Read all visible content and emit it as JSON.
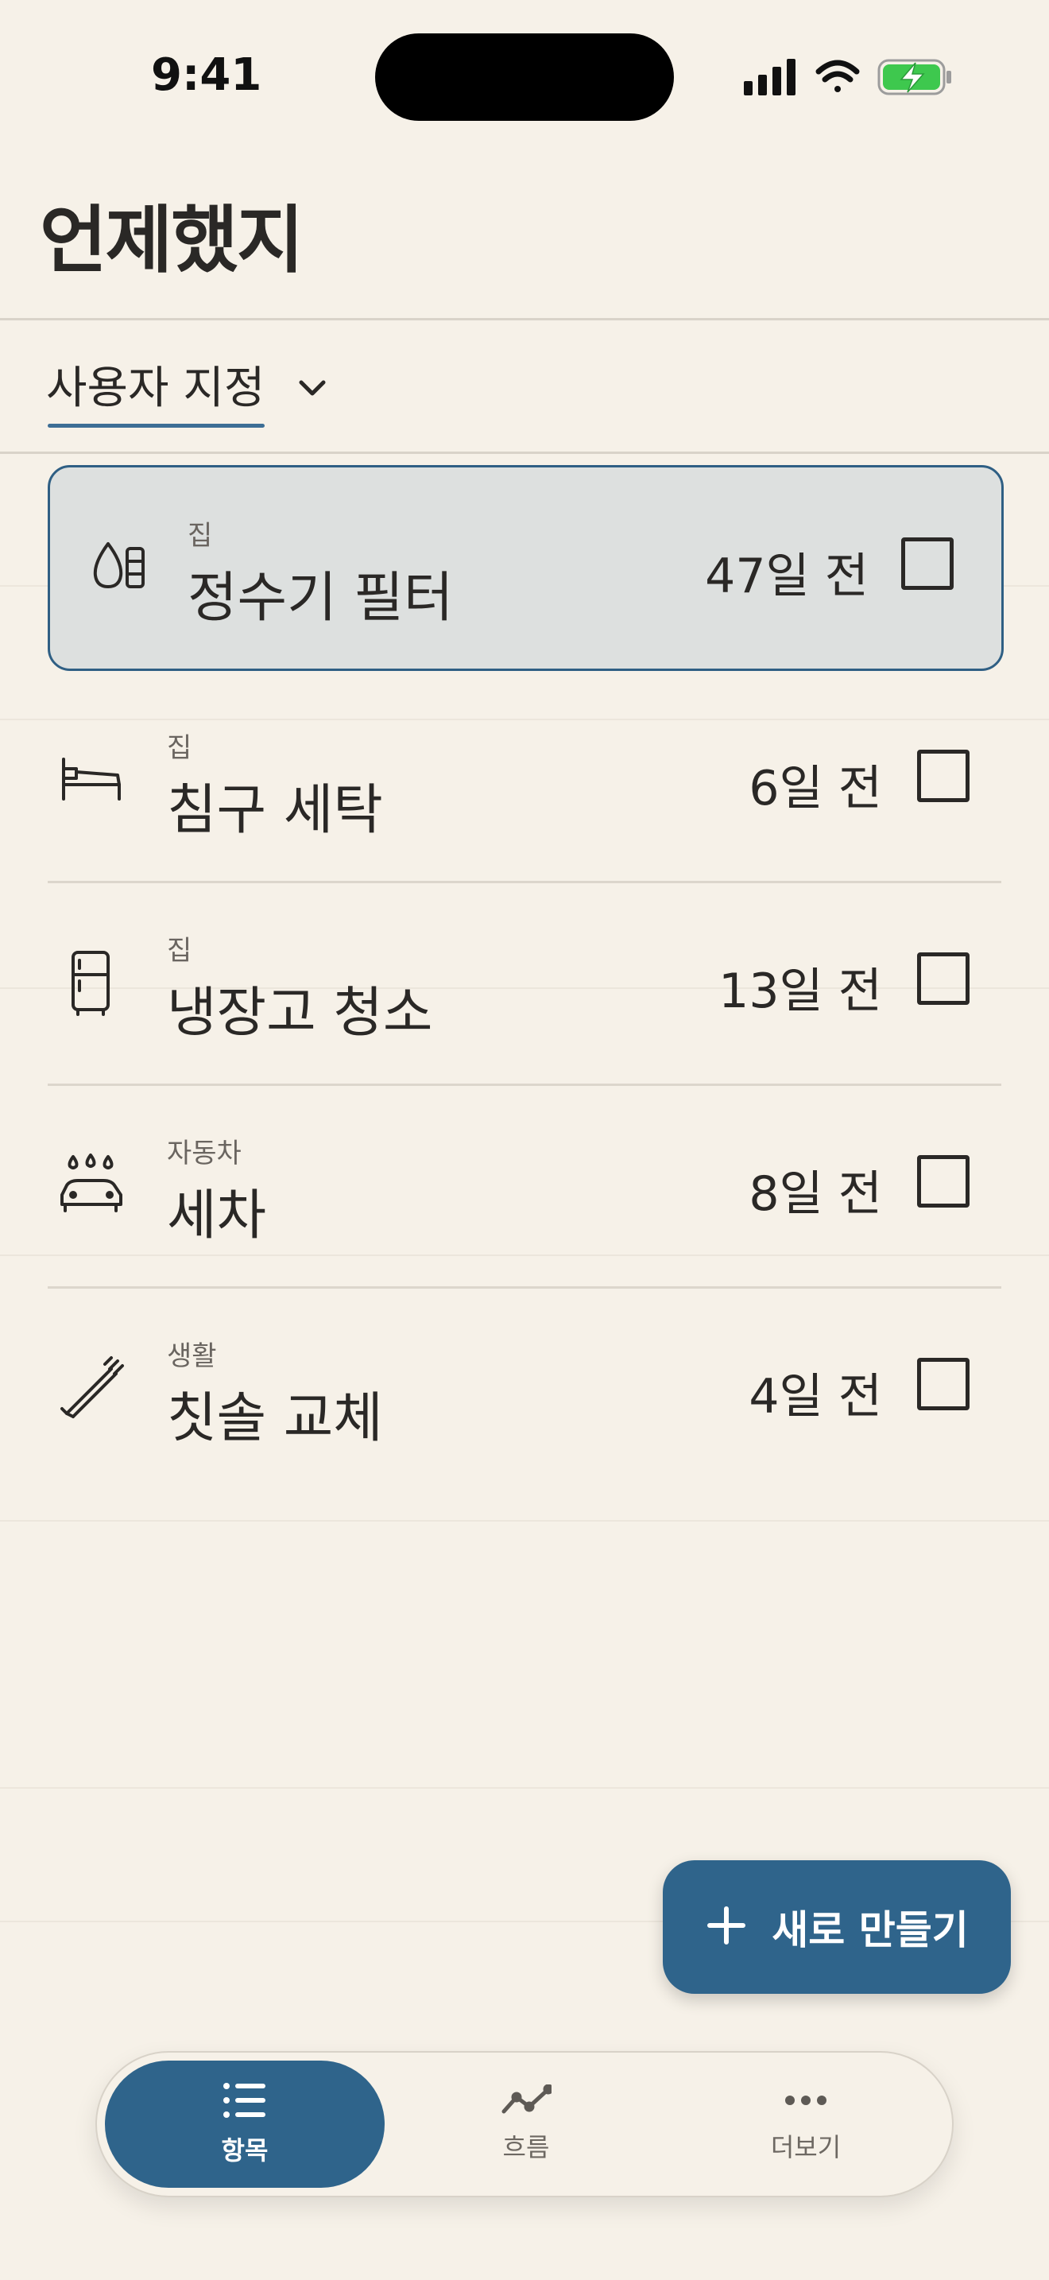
{
  "status": {
    "time": "9:41"
  },
  "app": {
    "title": "언제했지"
  },
  "filter": {
    "label": "사용자 지정"
  },
  "items": [
    {
      "category": "집",
      "name": "정수기 필터",
      "days": "47일 전",
      "icon": "water-filter-icon",
      "selected": true
    },
    {
      "category": "집",
      "name": "침구 세탁",
      "days": "6일 전",
      "icon": "bed-icon"
    },
    {
      "category": "집",
      "name": "냉장고 청소",
      "days": "13일 전",
      "icon": "fridge-icon"
    },
    {
      "category": "자동차",
      "name": "세차",
      "days": "8일 전",
      "icon": "car-wash-icon"
    },
    {
      "category": "생활",
      "name": "칫솔 교체",
      "days": "4일 전",
      "icon": "toothbrush-icon"
    }
  ],
  "fab": {
    "label": "새로 만들기",
    "icon": "plus-icon"
  },
  "tabs": [
    {
      "label": "항목",
      "icon": "list-icon",
      "active": true
    },
    {
      "label": "흐름",
      "icon": "trend-icon"
    },
    {
      "label": "더보기",
      "icon": "more-icon"
    }
  ],
  "colors": {
    "accent": "#2f648b",
    "background": "#f6f1e8",
    "selected_row": "#dde0df"
  }
}
